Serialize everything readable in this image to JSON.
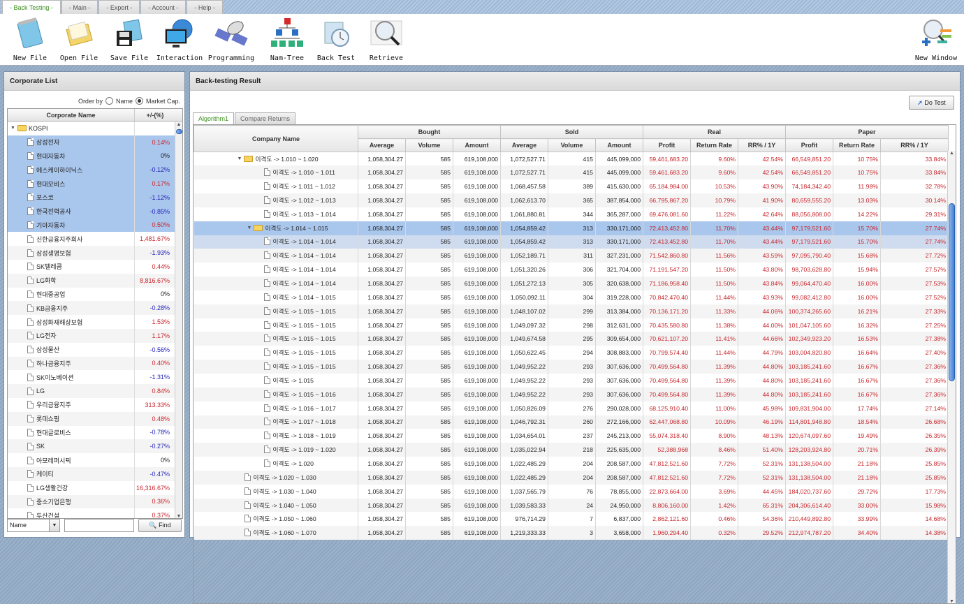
{
  "menu_tabs": [
    "- Back Testing -",
    "- Main -",
    "- Export -",
    "- Account -",
    "- Help -"
  ],
  "toolbar": [
    {
      "label": "New File",
      "icon": "notepad-icon"
    },
    {
      "label": "Open File",
      "icon": "folder-open-icon"
    },
    {
      "label": "Save File",
      "icon": "floppy-save-icon"
    },
    {
      "label": "Interaction",
      "icon": "globe-monitor-icon"
    },
    {
      "label": "Programming",
      "icon": "satellite-icon"
    },
    {
      "label": "Nam-Tree",
      "icon": "hierarchy-tree-icon"
    },
    {
      "label": "Back Test",
      "icon": "clock-folder-icon"
    },
    {
      "label": "Retrieve",
      "icon": "magnifier-chart-icon"
    }
  ],
  "new_window_label": "New Window",
  "left": {
    "title": "Corporate List",
    "order_by": "Order by",
    "order_options": [
      "Name",
      "Market Cap."
    ],
    "order_selected": "Market Cap.",
    "col_name": "Corporate Name",
    "col_pct": "+/-(%)",
    "root": "KOSPI",
    "items": [
      {
        "name": "삼성전자",
        "pct": "0.14%",
        "sign": "pos",
        "selected": true
      },
      {
        "name": "현대자동차",
        "pct": "0%",
        "sign": "zero",
        "selected": true
      },
      {
        "name": "에스케이하이닉스",
        "pct": "-0.12%",
        "sign": "neg",
        "selected": true
      },
      {
        "name": "현대모비스",
        "pct": "0.17%",
        "sign": "pos",
        "selected": true
      },
      {
        "name": "포스코",
        "pct": "-1.12%",
        "sign": "neg",
        "selected": true
      },
      {
        "name": "한국전력공사",
        "pct": "-0.85%",
        "sign": "neg",
        "selected": true
      },
      {
        "name": "기아자동차",
        "pct": "0.50%",
        "sign": "pos",
        "selected": true
      },
      {
        "name": "신한금융지주회사",
        "pct": "1,481.67%",
        "sign": "pos"
      },
      {
        "name": "삼성생명보험",
        "pct": "-1.93%",
        "sign": "neg"
      },
      {
        "name": "SK텔레콤",
        "pct": "0.44%",
        "sign": "pos"
      },
      {
        "name": "LG화학",
        "pct": "8,816.67%",
        "sign": "pos"
      },
      {
        "name": "현대중공업",
        "pct": "0%",
        "sign": "zero"
      },
      {
        "name": "KB금융지주",
        "pct": "-0.28%",
        "sign": "neg"
      },
      {
        "name": "삼성화재해상보험",
        "pct": "1.53%",
        "sign": "pos"
      },
      {
        "name": "LG전자",
        "pct": "1.17%",
        "sign": "pos"
      },
      {
        "name": "삼성물산",
        "pct": "-0.56%",
        "sign": "neg"
      },
      {
        "name": "하나금융지주",
        "pct": "0.40%",
        "sign": "pos"
      },
      {
        "name": "SK이노베이션",
        "pct": "-1.31%",
        "sign": "neg"
      },
      {
        "name": "LG",
        "pct": "0.84%",
        "sign": "pos"
      },
      {
        "name": "우리금융지주",
        "pct": "313.33%",
        "sign": "pos"
      },
      {
        "name": "롯데쇼핑",
        "pct": "0.48%",
        "sign": "pos"
      },
      {
        "name": "현대글로비스",
        "pct": "-0.78%",
        "sign": "neg"
      },
      {
        "name": "SK",
        "pct": "-0.27%",
        "sign": "neg"
      },
      {
        "name": "아모레퍼시픽",
        "pct": "0%",
        "sign": "zero"
      },
      {
        "name": "케이티",
        "pct": "-0.47%",
        "sign": "neg"
      },
      {
        "name": "LG생활건강",
        "pct": "16,316.67%",
        "sign": "pos"
      },
      {
        "name": "중소기업은행",
        "pct": "0.36%",
        "sign": "pos"
      },
      {
        "name": "두산건설",
        "pct": "0.37%",
        "sign": "pos"
      }
    ],
    "search_field": "Name",
    "search_value": "",
    "find_label": "Find"
  },
  "right": {
    "title": "Back-testing Result",
    "do_test": "Do Test",
    "tabs": [
      "Algorithm1",
      "Compare Returns"
    ],
    "col_company": "Company Name",
    "groups": [
      "Bought",
      "Sold",
      "Real",
      "Paper"
    ],
    "subcols": [
      "Average",
      "Volume",
      "Amount",
      "Average",
      "Volume",
      "Amount",
      "Profit",
      "Return Rate",
      "RR% / 1Y",
      "Profit",
      "Return Rate",
      "RR% / 1Y"
    ],
    "rows": [
      {
        "lvl": 1,
        "folder": true,
        "name": "이격도 -> 1.010 ~ 1.020",
        "c": [
          "1,058,304.27",
          "585",
          "619,108,000",
          "1,072,527.71",
          "415",
          "445,099,000",
          "59,461,683.20",
          "9.60%",
          "42.54%",
          "66,549,851.20",
          "10.75%",
          "33.84%"
        ]
      },
      {
        "lvl": 2,
        "name": "이격도 -> 1.010 ~ 1.011",
        "c": [
          "1,058,304.27",
          "585",
          "619,108,000",
          "1,072,527.71",
          "415",
          "445,099,000",
          "59,461,683.20",
          "9.60%",
          "42.54%",
          "66,549,851.20",
          "10.75%",
          "33.84%"
        ]
      },
      {
        "lvl": 2,
        "name": "이격도 -> 1.011 ~ 1.012",
        "c": [
          "1,058,304.27",
          "585",
          "619,108,000",
          "1,068,457.58",
          "389",
          "415,630,000",
          "65,184,984.00",
          "10.53%",
          "43.90%",
          "74,184,342.40",
          "11.98%",
          "32.78%"
        ]
      },
      {
        "lvl": 2,
        "name": "이격도 -> 1.012 ~ 1.013",
        "c": [
          "1,058,304.27",
          "585",
          "619,108,000",
          "1,062,613.70",
          "365",
          "387,854,000",
          "66,795,867.20",
          "10.79%",
          "41.90%",
          "80,659,555.20",
          "13.03%",
          "30.14%"
        ]
      },
      {
        "lvl": 2,
        "name": "이격도 -> 1.013 ~ 1.014",
        "c": [
          "1,058,304.27",
          "585",
          "619,108,000",
          "1,061,880.81",
          "344",
          "365,287,000",
          "69,476,081.60",
          "11.22%",
          "42.64%",
          "88,056,808.00",
          "14.22%",
          "29.31%"
        ]
      },
      {
        "lvl": 2,
        "folder": true,
        "state": "sel",
        "name": "이격도 -> 1.014 ~ 1.015",
        "c": [
          "1,058,304.27",
          "585",
          "619,108,000",
          "1,054,859.42",
          "313",
          "330,171,000",
          "72,413,452.80",
          "11.70%",
          "43.44%",
          "97,179,521.60",
          "15.70%",
          "27.74%"
        ]
      },
      {
        "lvl": 3,
        "state": "sel2",
        "name": "이격도 -> 1.014 ~ 1.014",
        "c": [
          "1,058,304.27",
          "585",
          "619,108,000",
          "1,054,859.42",
          "313",
          "330,171,000",
          "72,413,452.80",
          "11.70%",
          "43.44%",
          "97,179,521.60",
          "15.70%",
          "27.74%"
        ]
      },
      {
        "lvl": 3,
        "name": "이격도 -> 1.014 ~ 1.014",
        "c": [
          "1,058,304.27",
          "585",
          "619,108,000",
          "1,052,189.71",
          "311",
          "327,231,000",
          "71,542,860.80",
          "11.56%",
          "43.59%",
          "97,095,790.40",
          "15.68%",
          "27.72%"
        ]
      },
      {
        "lvl": 3,
        "name": "이격도 -> 1.014 ~ 1.014",
        "c": [
          "1,058,304.27",
          "585",
          "619,108,000",
          "1,051,320.26",
          "306",
          "321,704,000",
          "71,191,547.20",
          "11.50%",
          "43.80%",
          "98,703,628.80",
          "15.94%",
          "27.57%"
        ]
      },
      {
        "lvl": 3,
        "name": "이격도 -> 1.014 ~ 1.014",
        "c": [
          "1,058,304.27",
          "585",
          "619,108,000",
          "1,051,272.13",
          "305",
          "320,638,000",
          "71,186,958.40",
          "11.50%",
          "43.84%",
          "99,064,470.40",
          "16.00%",
          "27.53%"
        ]
      },
      {
        "lvl": 3,
        "name": "이격도 -> 1.014 ~ 1.015",
        "c": [
          "1,058,304.27",
          "585",
          "619,108,000",
          "1,050,092.11",
          "304",
          "319,228,000",
          "70,842,470.40",
          "11.44%",
          "43.93%",
          "99,082,412.80",
          "16.00%",
          "27.52%"
        ]
      },
      {
        "lvl": 3,
        "name": "이격도 -> 1.015 ~ 1.015",
        "c": [
          "1,058,304.27",
          "585",
          "619,108,000",
          "1,048,107.02",
          "299",
          "313,384,000",
          "70,136,171.20",
          "11.33%",
          "44.06%",
          "100,374,265.60",
          "16.21%",
          "27.33%"
        ]
      },
      {
        "lvl": 3,
        "name": "이격도 -> 1.015 ~ 1.015",
        "c": [
          "1,058,304.27",
          "585",
          "619,108,000",
          "1,049,097.32",
          "298",
          "312,631,000",
          "70,435,580.80",
          "11.38%",
          "44.00%",
          "101,047,105.60",
          "16.32%",
          "27.25%"
        ]
      },
      {
        "lvl": 3,
        "name": "이격도 -> 1.015 ~ 1.015",
        "c": [
          "1,058,304.27",
          "585",
          "619,108,000",
          "1,049,674.58",
          "295",
          "309,654,000",
          "70,621,107.20",
          "11.41%",
          "44.66%",
          "102,349,923.20",
          "16.53%",
          "27.38%"
        ]
      },
      {
        "lvl": 3,
        "name": "이격도 -> 1.015 ~ 1.015",
        "c": [
          "1,058,304.27",
          "585",
          "619,108,000",
          "1,050,622.45",
          "294",
          "308,883,000",
          "70,799,574.40",
          "11.44%",
          "44.79%",
          "103,004,820.80",
          "16.64%",
          "27.40%"
        ]
      },
      {
        "lvl": 3,
        "name": "이격도 -> 1.015 ~ 1.015",
        "c": [
          "1,058,304.27",
          "585",
          "619,108,000",
          "1,049,952.22",
          "293",
          "307,636,000",
          "70,499,564.80",
          "11.39%",
          "44.80%",
          "103,185,241.60",
          "16.67%",
          "27.36%"
        ]
      },
      {
        "lvl": 3,
        "name": "이격도 -> 1.015",
        "c": [
          "1,058,304.27",
          "585",
          "619,108,000",
          "1,049,952.22",
          "293",
          "307,636,000",
          "70,499,564.80",
          "11.39%",
          "44.80%",
          "103,185,241.60",
          "16.67%",
          "27.36%"
        ]
      },
      {
        "lvl": 2,
        "name": "이격도 -> 1.015 ~ 1.016",
        "c": [
          "1,058,304.27",
          "585",
          "619,108,000",
          "1,049,952.22",
          "293",
          "307,636,000",
          "70,499,564.80",
          "11.39%",
          "44.80%",
          "103,185,241.60",
          "16.67%",
          "27.36%"
        ]
      },
      {
        "lvl": 2,
        "name": "이격도 -> 1.016 ~ 1.017",
        "c": [
          "1,058,304.27",
          "585",
          "619,108,000",
          "1,050,826.09",
          "276",
          "290,028,000",
          "68,125,910.40",
          "11.00%",
          "45.98%",
          "109,831,904.00",
          "17.74%",
          "27.14%"
        ]
      },
      {
        "lvl": 2,
        "name": "이격도 -> 1.017 ~ 1.018",
        "c": [
          "1,058,304.27",
          "585",
          "619,108,000",
          "1,046,792.31",
          "260",
          "272,166,000",
          "62,447,068.80",
          "10.09%",
          "46.19%",
          "114,801,948.80",
          "18.54%",
          "26.68%"
        ]
      },
      {
        "lvl": 2,
        "name": "이격도 -> 1.018 ~ 1.019",
        "c": [
          "1,058,304.27",
          "585",
          "619,108,000",
          "1,034,654.01",
          "237",
          "245,213,000",
          "55,074,318.40",
          "8.90%",
          "48.13%",
          "120,674,097.60",
          "19.49%",
          "26.35%"
        ]
      },
      {
        "lvl": 2,
        "name": "이격도 -> 1.019 ~ 1.020",
        "c": [
          "1,058,304.27",
          "585",
          "619,108,000",
          "1,035,022.94",
          "218",
          "225,635,000",
          "52,388,968",
          "8.46%",
          "51.40%",
          "128,203,924.80",
          "20.71%",
          "26.39%"
        ]
      },
      {
        "lvl": 2,
        "name": "이격도 -> 1.020",
        "c": [
          "1,058,304.27",
          "585",
          "619,108,000",
          "1,022,485.29",
          "204",
          "208,587,000",
          "47,812,521.60",
          "7.72%",
          "52.31%",
          "131,138,504.00",
          "21.18%",
          "25.85%"
        ]
      },
      {
        "lvl": 1,
        "name": "이격도 -> 1.020 ~ 1.030",
        "c": [
          "1,058,304.27",
          "585",
          "619,108,000",
          "1,022,485.29",
          "204",
          "208,587,000",
          "47,812,521.60",
          "7.72%",
          "52.31%",
          "131,138,504.00",
          "21.18%",
          "25.85%"
        ]
      },
      {
        "lvl": 1,
        "name": "이격도 -> 1.030 ~ 1.040",
        "c": [
          "1,058,304.27",
          "585",
          "619,108,000",
          "1,037,565.79",
          "76",
          "78,855,000",
          "22,873,664.00",
          "3.69%",
          "44.45%",
          "184,020,737.60",
          "29.72%",
          "17.73%"
        ]
      },
      {
        "lvl": 1,
        "name": "이격도 -> 1.040 ~ 1.050",
        "c": [
          "1,058,304.27",
          "585",
          "619,108,000",
          "1,039,583.33",
          "24",
          "24,950,000",
          "8,806,160.00",
          "1.42%",
          "65.31%",
          "204,306,614.40",
          "33.00%",
          "15.98%"
        ]
      },
      {
        "lvl": 1,
        "name": "이격도 -> 1.050 ~ 1.060",
        "c": [
          "1,058,304.27",
          "585",
          "619,108,000",
          "976,714.29",
          "7",
          "6,837,000",
          "2,862,121.60",
          "0.46%",
          "54.36%",
          "210,449,892.80",
          "33.99%",
          "14.68%"
        ]
      },
      {
        "lvl": 1,
        "name": "이격도 -> 1.060 ~ 1.070",
        "c": [
          "1,058,304.27",
          "585",
          "619,108,000",
          "1,219,333.33",
          "3",
          "3,658,000",
          "1,960,294.40",
          "0.32%",
          "29.52%",
          "212,974,787.20",
          "34.40%",
          "14.38%"
        ]
      }
    ]
  }
}
